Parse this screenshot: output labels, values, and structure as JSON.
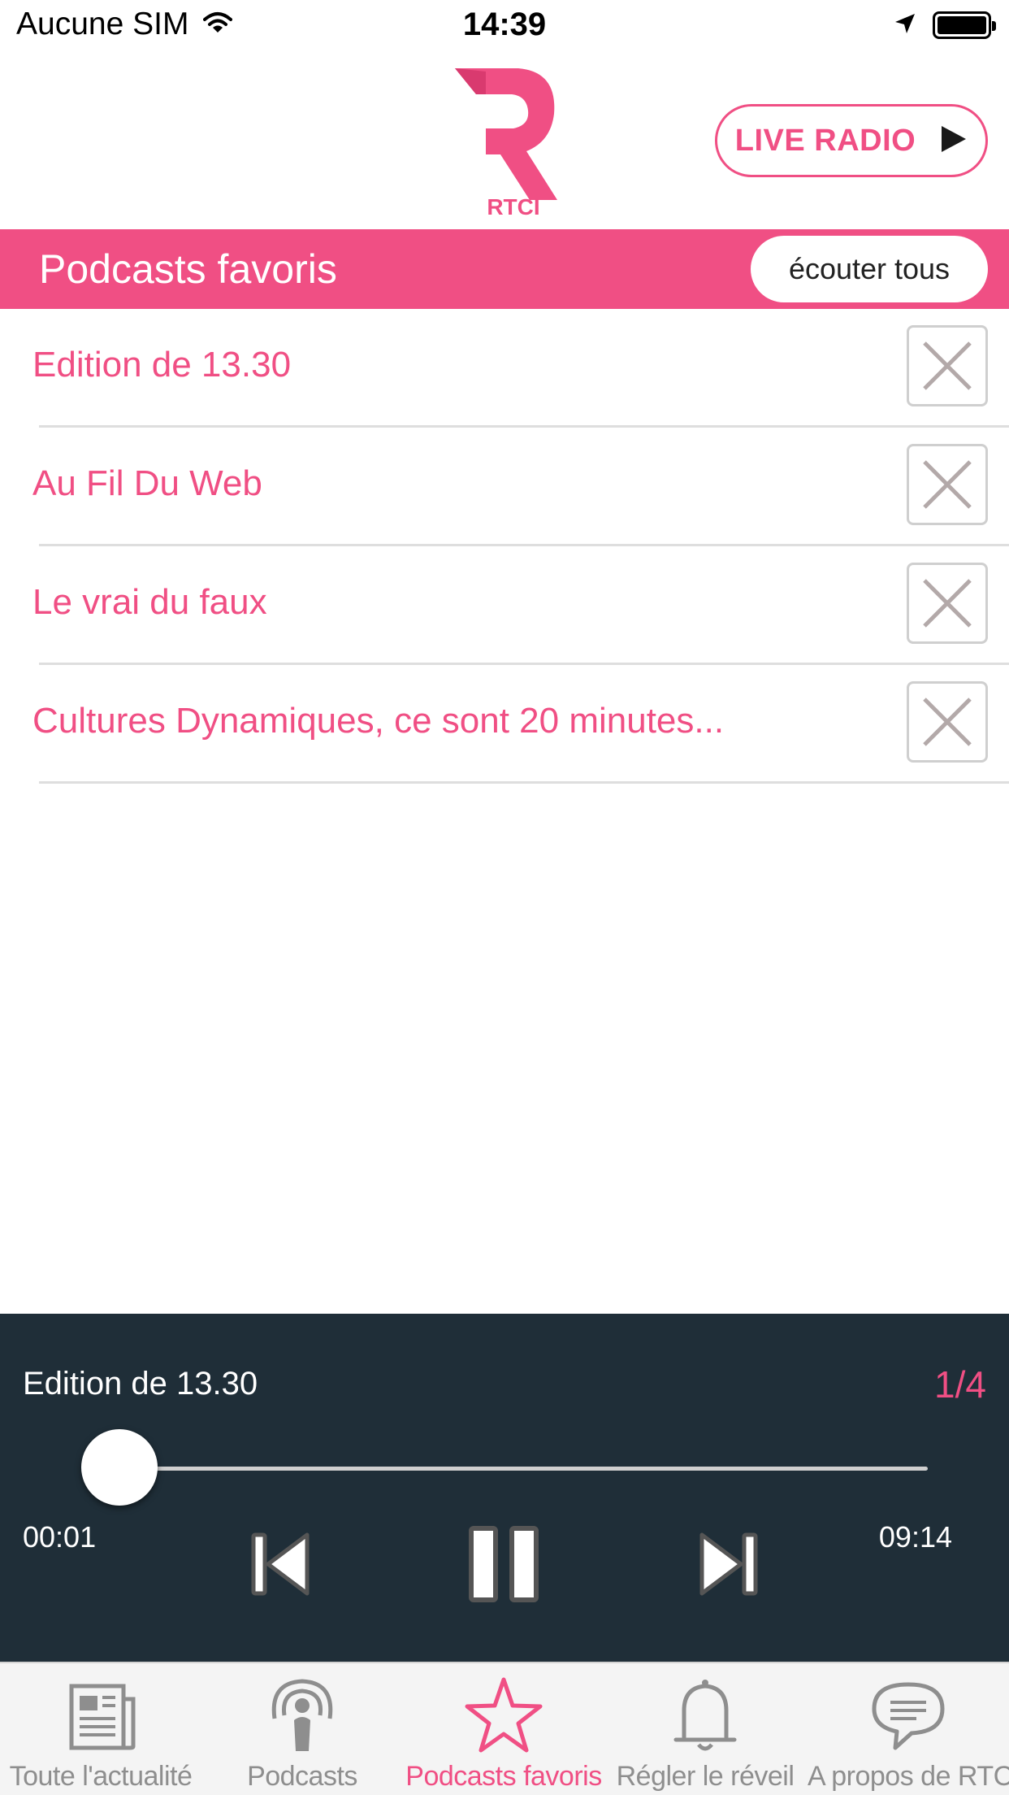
{
  "status_bar": {
    "carrier": "Aucune SIM",
    "time": "14:39"
  },
  "header": {
    "logo_text": "RTCI",
    "live_button_label": "LIVE RADIO"
  },
  "section": {
    "title": "Podcasts favoris",
    "listen_all_label": "écouter tous"
  },
  "favorites": [
    {
      "title": "Edition de 13.30"
    },
    {
      "title": "Au Fil Du Web"
    },
    {
      "title": "Le vrai du faux"
    },
    {
      "title": "Cultures Dynamiques, ce sont 20 minutes..."
    }
  ],
  "player": {
    "title": "Edition de 13.30",
    "counter": "1/4",
    "elapsed": "00:01",
    "duration": "09:14",
    "progress": 0.002
  },
  "tabs": [
    {
      "label": "Toute l'actualité",
      "icon": "newspaper-icon"
    },
    {
      "label": "Podcasts",
      "icon": "podcast-icon"
    },
    {
      "label": "Podcasts favoris",
      "icon": "star-icon",
      "active": true
    },
    {
      "label": "Régler le réveil",
      "icon": "bell-icon"
    },
    {
      "label": "A propos de RTCI",
      "icon": "chat-bubble-icon"
    }
  ],
  "colors": {
    "accent": "#f04f84",
    "player_bg": "#1f2e38",
    "tabbar_bg": "#f4f4f4",
    "inactive_tab": "#8e8e8e"
  }
}
